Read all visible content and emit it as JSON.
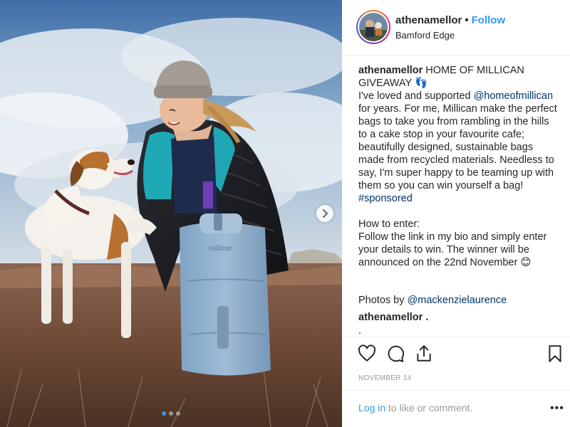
{
  "post": {
    "username": "athenamellor",
    "separator": "•",
    "follow_label": "Follow",
    "location": "Bamford Edge",
    "caption": {
      "username": "athenamellor",
      "line1": "HOME OF MILLICAN GIVEAWAY 👣",
      "para1_a": "I've loved and supported ",
      "mention1": "@homeofmillican",
      "para1_b": " for years. For me, Millican make the perfect bags to take you from rambling in the hills to a cake stop in your favourite cafe; beautifully designed, sustainable bags made from recycled materials. Needless to say, I'm super happy to be teaming up with them so you can win yourself a bag!",
      "hashtag": "#sponsored",
      "para2_title": "How to enter:",
      "para2_body": "Follow the link in my bio and simply enter your details to win. The winner will be announced on the 22nd November 😊"
    },
    "photos_by_prefix": "Photos by ",
    "photos_by_mention": "@mackenzielaurence",
    "comment_username": "athenamellor .",
    "comment_text": ".",
    "date": "NOVEMBER 14",
    "login_link": "Log in",
    "login_suffix": " to like or comment.",
    "more_label": "•••",
    "backpack_brand": "millican"
  },
  "icons": {
    "like": "heart-icon",
    "comment": "comment-icon",
    "share": "share-icon",
    "save": "bookmark-icon",
    "next": "chevron-right-icon"
  },
  "carousel": {
    "total": 3,
    "active_index": 0
  },
  "colors": {
    "link": "#003569",
    "accent": "#3897f0",
    "muted": "#999999"
  }
}
